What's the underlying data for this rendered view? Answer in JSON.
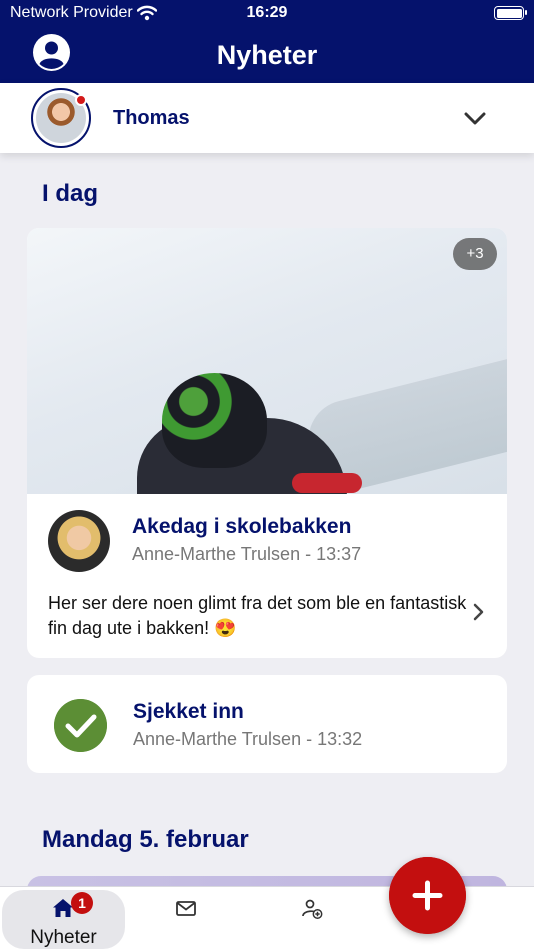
{
  "status_bar": {
    "carrier": "Network Provider",
    "time": "16:29"
  },
  "header": {
    "title": "Nyheter"
  },
  "child_selector": {
    "name": "Thomas"
  },
  "sections": {
    "today": "I dag",
    "monday": "Mandag 5. februar"
  },
  "post": {
    "more_photos": "+3",
    "title": "Akedag i skolebakken",
    "meta": "Anne-Marthe Trulsen - 13:37",
    "text": "Her ser dere noen glimt fra det som ble en fantastisk fin dag ute i bakken! 😍"
  },
  "checkin": {
    "title": "Sjekket inn",
    "meta": "Anne-Marthe Trulsen - 13:32"
  },
  "tabbar": {
    "home_label": "Nyheter",
    "home_badge": "1"
  },
  "colors": {
    "primary": "#05126c",
    "accent_red": "#c30f0f",
    "check_green": "#5c8e35"
  }
}
